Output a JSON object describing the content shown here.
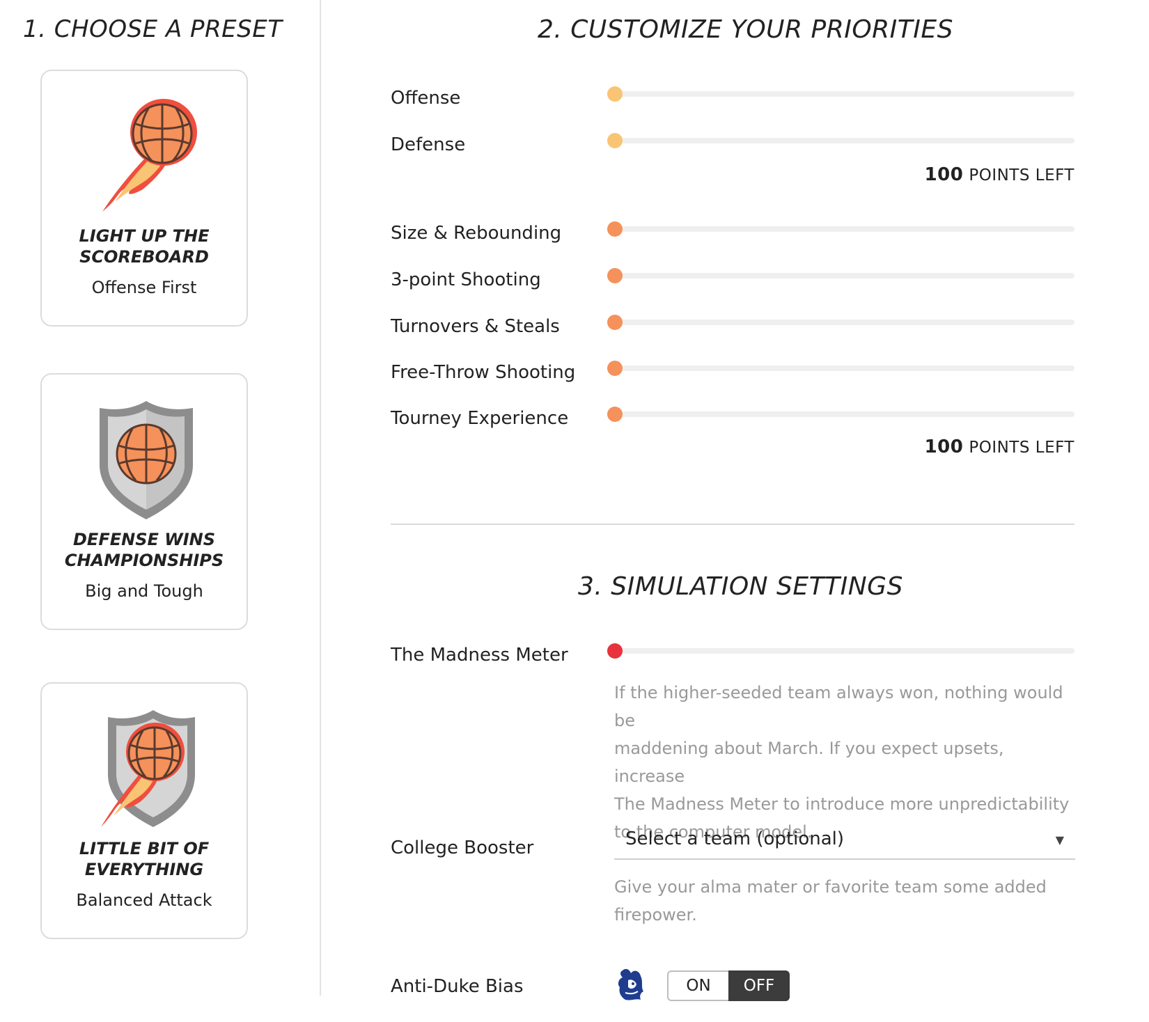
{
  "sections": {
    "preset_title": "1. CHOOSE A PRESET",
    "priorities_title": "2. CUSTOMIZE YOUR PRIORITIES",
    "simulation_title": "3. SIMULATION SETTINGS"
  },
  "presets": [
    {
      "title_line1": "LIGHT UP THE",
      "title_line2": "SCOREBOARD",
      "subtitle": "Offense First",
      "icon": "flaming-basketball-icon"
    },
    {
      "title_line1": "DEFENSE WINS",
      "title_line2": "CHAMPIONSHIPS",
      "subtitle": "Big and Tough",
      "icon": "shield-basketball-icon"
    },
    {
      "title_line1": "LITTLE BIT OF",
      "title_line2": "EVERYTHING",
      "subtitle": "Balanced Attack",
      "icon": "shield-flaming-basketball-icon"
    }
  ],
  "priority_groups": [
    {
      "sliders": [
        {
          "label": "Offense",
          "value": 0,
          "color": "#f9c473"
        },
        {
          "label": "Defense",
          "value": 0,
          "color": "#f9c473"
        }
      ],
      "points_left": "100",
      "points_left_label": "POINTS LEFT"
    },
    {
      "sliders": [
        {
          "label": "Size & Rebounding",
          "value": 0,
          "color": "#f5915a"
        },
        {
          "label": "3-point Shooting",
          "value": 0,
          "color": "#f5915a"
        },
        {
          "label": "Turnovers & Steals",
          "value": 0,
          "color": "#f5915a"
        },
        {
          "label": "Free-Throw Shooting",
          "value": 0,
          "color": "#f5915a"
        },
        {
          "label": "Tourney Experience",
          "value": 0,
          "color": "#f5915a"
        }
      ],
      "points_left": "100",
      "points_left_label": "POINTS LEFT"
    }
  ],
  "simulation": {
    "madness": {
      "label": "The Madness Meter",
      "value": 0,
      "color": "#e8323c",
      "description_lines": [
        "If the higher-seeded team always won, nothing would be",
        "maddening about March. If you expect upsets, increase",
        "The Madness Meter to introduce more unpredictability",
        "to the computer model."
      ]
    },
    "booster": {
      "label": "College Booster",
      "select_value": "Select a team (optional)",
      "caret": "▼",
      "description_lines": [
        "Give your alma mater or favorite team some added",
        "firepower."
      ]
    },
    "anti_duke": {
      "label": "Anti-Duke Bias",
      "icon": "blue-devil-icon",
      "on_label": "ON",
      "off_label": "OFF",
      "selected": "OFF"
    }
  }
}
